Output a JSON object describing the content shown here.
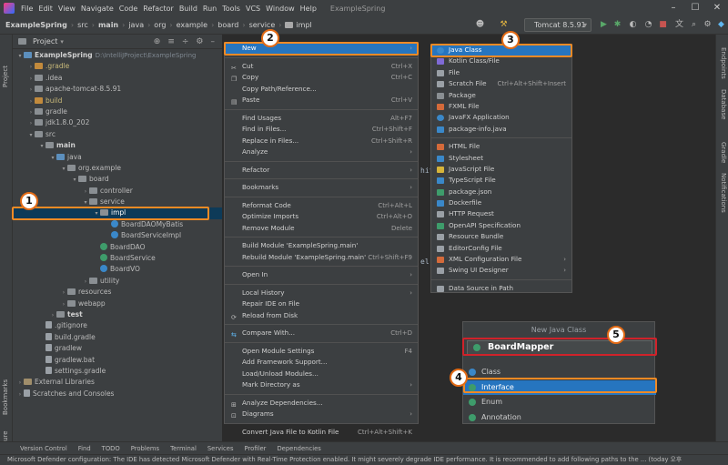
{
  "menubar": {
    "items": [
      "File",
      "Edit",
      "View",
      "Navigate",
      "Code",
      "Refactor",
      "Build",
      "Run",
      "Tools",
      "VCS",
      "Window",
      "Help"
    ],
    "window_title": "ExampleSpring"
  },
  "breadcrumb": [
    "ExampleSpring",
    "src",
    "main",
    "java",
    "org",
    "example",
    "board",
    "service",
    "impl"
  ],
  "run_config": "Tomcat 8.5.91",
  "project_panel": {
    "title": "Project",
    "tree": [
      {
        "label": "ExampleSpring",
        "note": "D:\\IntelliJProject\\ExampleSpring"
      },
      {
        "label": ".gradle"
      },
      {
        "label": ".idea"
      },
      {
        "label": "apache-tomcat-8.5.91"
      },
      {
        "label": "build"
      },
      {
        "label": "gradle"
      },
      {
        "label": "jdk1.8.0_202"
      },
      {
        "label": "src"
      },
      {
        "label": "main"
      },
      {
        "label": "java"
      },
      {
        "label": "org.example"
      },
      {
        "label": "board"
      },
      {
        "label": "controller"
      },
      {
        "label": "service"
      },
      {
        "label": "impl"
      },
      {
        "label": "BoardDAOMyBatis"
      },
      {
        "label": "BoardServiceImpl"
      },
      {
        "label": "BoardDAO"
      },
      {
        "label": "BoardService"
      },
      {
        "label": "BoardVO"
      },
      {
        "label": "utility"
      },
      {
        "label": "resources"
      },
      {
        "label": "webapp"
      },
      {
        "label": "test"
      },
      {
        "label": ".gitignore"
      },
      {
        "label": "build.gradle"
      },
      {
        "label": "gradlew"
      },
      {
        "label": "gradlew.bat"
      },
      {
        "label": "settings.gradle"
      },
      {
        "label": "External Libraries"
      },
      {
        "label": "Scratches and Consoles"
      }
    ]
  },
  "context_menu": {
    "items": [
      {
        "label": "New",
        "shortcut": "",
        "submenu": true
      },
      {
        "label": "Cut",
        "shortcut": "Ctrl+X"
      },
      {
        "label": "Copy",
        "shortcut": "Ctrl+C"
      },
      {
        "label": "Copy Path/Reference...",
        "shortcut": ""
      },
      {
        "label": "Paste",
        "shortcut": "Ctrl+V"
      },
      {
        "label": "Find Usages",
        "shortcut": "Alt+F7"
      },
      {
        "label": "Find in Files...",
        "shortcut": "Ctrl+Shift+F"
      },
      {
        "label": "Replace in Files...",
        "shortcut": "Ctrl+Shift+R"
      },
      {
        "label": "Analyze",
        "shortcut": "",
        "submenu": true
      },
      {
        "label": "Refactor",
        "shortcut": "",
        "submenu": true
      },
      {
        "label": "Bookmarks",
        "shortcut": "",
        "submenu": true
      },
      {
        "label": "Reformat Code",
        "shortcut": "Ctrl+Alt+L"
      },
      {
        "label": "Optimize Imports",
        "shortcut": "Ctrl+Alt+O"
      },
      {
        "label": "Remove Module",
        "shortcut": "Delete"
      },
      {
        "label": "Build Module 'ExampleSpring.main'",
        "shortcut": ""
      },
      {
        "label": "Rebuild Module 'ExampleSpring.main'",
        "shortcut": "Ctrl+Shift+F9"
      },
      {
        "label": "Open In",
        "shortcut": "",
        "submenu": true
      },
      {
        "label": "Local History",
        "shortcut": "",
        "submenu": true
      },
      {
        "label": "Repair IDE on File",
        "shortcut": ""
      },
      {
        "label": "Reload from Disk",
        "shortcut": ""
      },
      {
        "label": "Compare With...",
        "shortcut": "Ctrl+D"
      },
      {
        "label": "Open Module Settings",
        "shortcut": "F4"
      },
      {
        "label": "Add Framework Support...",
        "shortcut": ""
      },
      {
        "label": "Load/Unload Modules...",
        "shortcut": ""
      },
      {
        "label": "Mark Directory as",
        "shortcut": "",
        "submenu": true
      },
      {
        "label": "Analyze Dependencies...",
        "shortcut": ""
      },
      {
        "label": "Diagrams",
        "shortcut": "",
        "submenu": true
      },
      {
        "label": "Convert Java File to Kotlin File",
        "shortcut": "Ctrl+Alt+Shift+K"
      }
    ]
  },
  "new_submenu": {
    "items": [
      {
        "label": "Java Class",
        "shortcut": "",
        "color": "#3a88c9"
      },
      {
        "label": "Kotlin Class/File",
        "shortcut": "",
        "color": "#7f6ad6"
      },
      {
        "label": "File",
        "shortcut": "",
        "color": "#9aa0a6"
      },
      {
        "label": "Scratch File",
        "shortcut": "Ctrl+Alt+Shift+Insert",
        "color": "#9aa0a6"
      },
      {
        "label": "Package",
        "shortcut": "",
        "color": "#8a8f93"
      },
      {
        "label": "FXML File",
        "shortcut": "",
        "color": "#d46a3a"
      },
      {
        "label": "JavaFX Application",
        "shortcut": "",
        "color": "#3a88c9"
      },
      {
        "label": "package-info.java",
        "shortcut": "",
        "color": "#3a88c9"
      },
      {
        "label": "HTML File",
        "shortcut": "",
        "color": "#d46a3a"
      },
      {
        "label": "Stylesheet",
        "shortcut": "",
        "color": "#3a88c9"
      },
      {
        "label": "JavaScript File",
        "shortcut": "",
        "color": "#d6b43a"
      },
      {
        "label": "TypeScript File",
        "shortcut": "",
        "color": "#3a88c9"
      },
      {
        "label": "package.json",
        "shortcut": "",
        "color": "#3e9c6b"
      },
      {
        "label": "Dockerfile",
        "shortcut": "",
        "color": "#3a88c9"
      },
      {
        "label": "HTTP Request",
        "shortcut": "",
        "color": "#9aa0a6"
      },
      {
        "label": "OpenAPI Specification",
        "shortcut": "",
        "color": "#3e9c6b"
      },
      {
        "label": "Resource Bundle",
        "shortcut": "",
        "color": "#9aa0a6"
      },
      {
        "label": "EditorConfig File",
        "shortcut": "",
        "color": "#9aa0a6"
      },
      {
        "label": "XML Configuration File",
        "shortcut": "",
        "color": "#d46a3a",
        "submenu": true
      },
      {
        "label": "Swing UI Designer",
        "shortcut": "",
        "color": "#9aa0a6",
        "submenu": true
      },
      {
        "label": "Data Source in Path",
        "shortcut": "",
        "color": "#9aa0a6"
      }
    ]
  },
  "new_java_class": {
    "title": "New Java Class",
    "name_value": "BoardMapper",
    "kinds": [
      {
        "label": "Class",
        "color": "#3a88c9"
      },
      {
        "label": "Interface",
        "color": "#3e9c6b"
      },
      {
        "label": "Enum",
        "color": "#3e9c6b"
      },
      {
        "label": "Annotation",
        "color": "#3e9c6b"
      }
    ]
  },
  "badges": [
    "1",
    "2",
    "3",
    "4",
    "5"
  ],
  "side_tabs": {
    "left_top": "Project",
    "left_bottom": [
      "Bookmarks",
      "Structure"
    ],
    "right": [
      "Endpoints",
      "Database",
      "Gradle",
      "Notifications"
    ]
  },
  "bottom_toolbar": [
    "Version Control",
    "Find",
    "TODO",
    "Problems",
    "Terminal",
    "Services",
    "Profiler",
    "Dependencies"
  ],
  "status_text": "Microsoft Defender configuration: The IDE has detected Microsoft Defender with Real-Time Protection enabled. It might severely degrade IDE performance. It is recommended to add following paths to the ... (today 오후",
  "editor_fragments": [
    "hif",
    "el"
  ],
  "colors": {
    "highlight_orange": "#f08a24",
    "highlight_red": "#d0222a",
    "selection_blue": "#2675bf"
  }
}
